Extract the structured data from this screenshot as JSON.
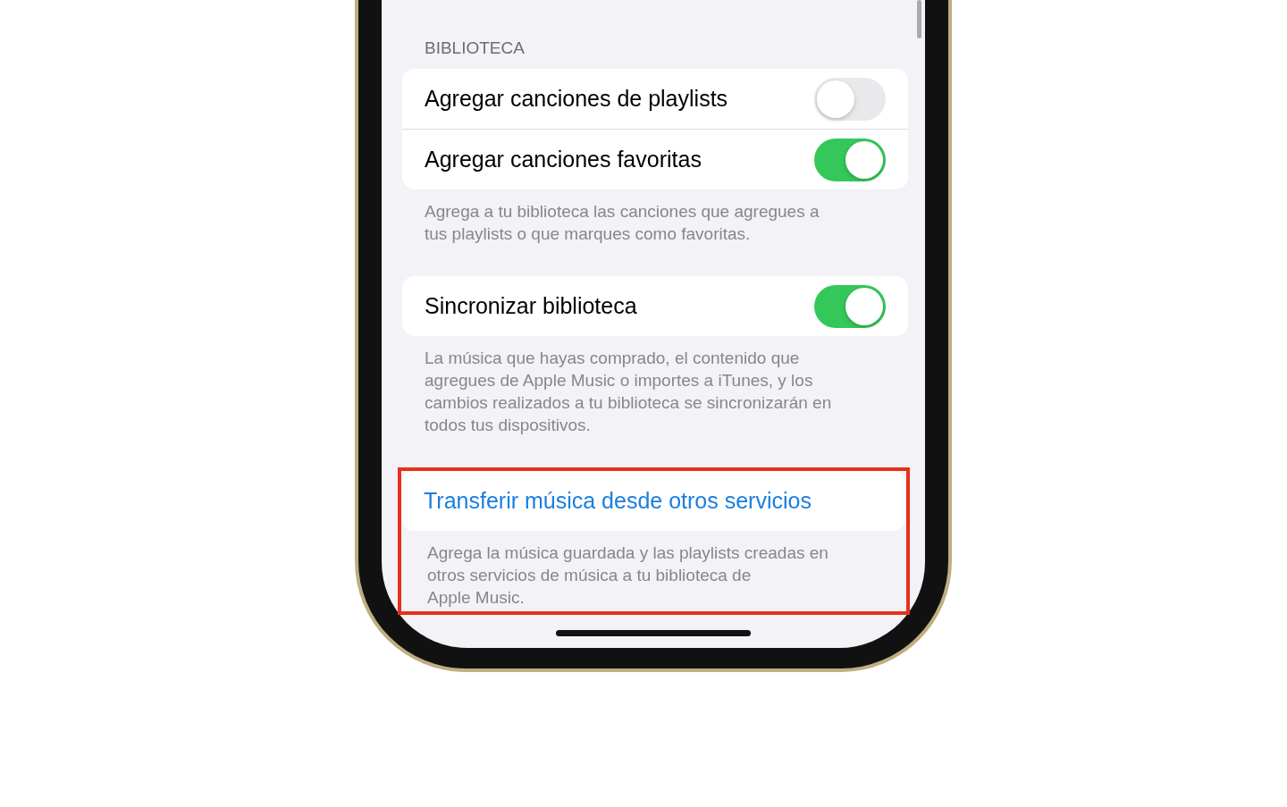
{
  "section_header": "BIBLIOTECA",
  "groups": [
    {
      "highlighted": false,
      "rows": [
        {
          "kind": "toggle",
          "label": "Agregar canciones de playlists",
          "on": false
        },
        {
          "kind": "toggle",
          "label": "Agregar canciones favoritas",
          "on": true
        }
      ],
      "footer": "Agrega a tu biblioteca las canciones que agregues a\ntus playlists o que marques como favoritas."
    },
    {
      "highlighted": false,
      "rows": [
        {
          "kind": "toggle",
          "label": "Sincronizar biblioteca",
          "on": true
        }
      ],
      "footer": "La música que hayas comprado, el contenido que\nagregues de Apple Music o importes a iTunes, y los\ncambios realizados a tu biblioteca se sincronizarán en\ntodos tus dispositivos."
    },
    {
      "highlighted": true,
      "rows": [
        {
          "kind": "link",
          "label": "Transferir música desde otros servicios"
        }
      ],
      "footer": "Agrega la música guardada y las playlists creadas en\notros servicios de música a tu biblioteca de\nApple Music."
    }
  ]
}
